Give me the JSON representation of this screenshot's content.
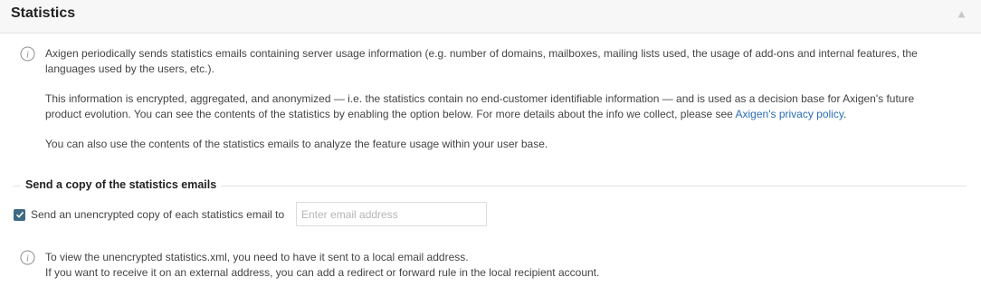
{
  "header": {
    "title": "Statistics",
    "collapse_icon": "triangle-up-icon"
  },
  "intro": {
    "icon": "info-icon",
    "paragraph1": "Axigen periodically sends statistics emails containing server usage information (e.g. number of domains, mailboxes, mailing lists used, the usage of add-ons and internal features, the languages used by the users, etc.).",
    "paragraph2_text": "This information is encrypted, aggregated, and anonymized — i.e. the statistics contain no end-customer identifiable information — and is used as a decision base for Axigen's future product evolution. You can see the contents of the statistics by enabling the option below. For more details about the info we collect, please see ",
    "paragraph2_link": "Axigen's privacy policy",
    "paragraph2_end": ".",
    "paragraph3": "You can also use the contents of the statistics emails to analyze the feature usage within your user base."
  },
  "copy_section": {
    "title": "Send a copy of the statistics emails",
    "checkbox_label": "Send an unencrypted copy of each statistics email to",
    "checkbox_checked": true,
    "email_value": "",
    "email_placeholder": "Enter email address",
    "checkbox_color": "#3d6a84"
  },
  "note": {
    "icon": "info-icon",
    "line1": "To view the unencrypted statistics.xml, you need to have it sent to a local email address.",
    "line2": "If you want to receive it on an external address, you can add a redirect or forward rule in the local recipient account."
  },
  "colors": {
    "link": "#2a6db5",
    "header_bg": "#f7f7f7"
  }
}
